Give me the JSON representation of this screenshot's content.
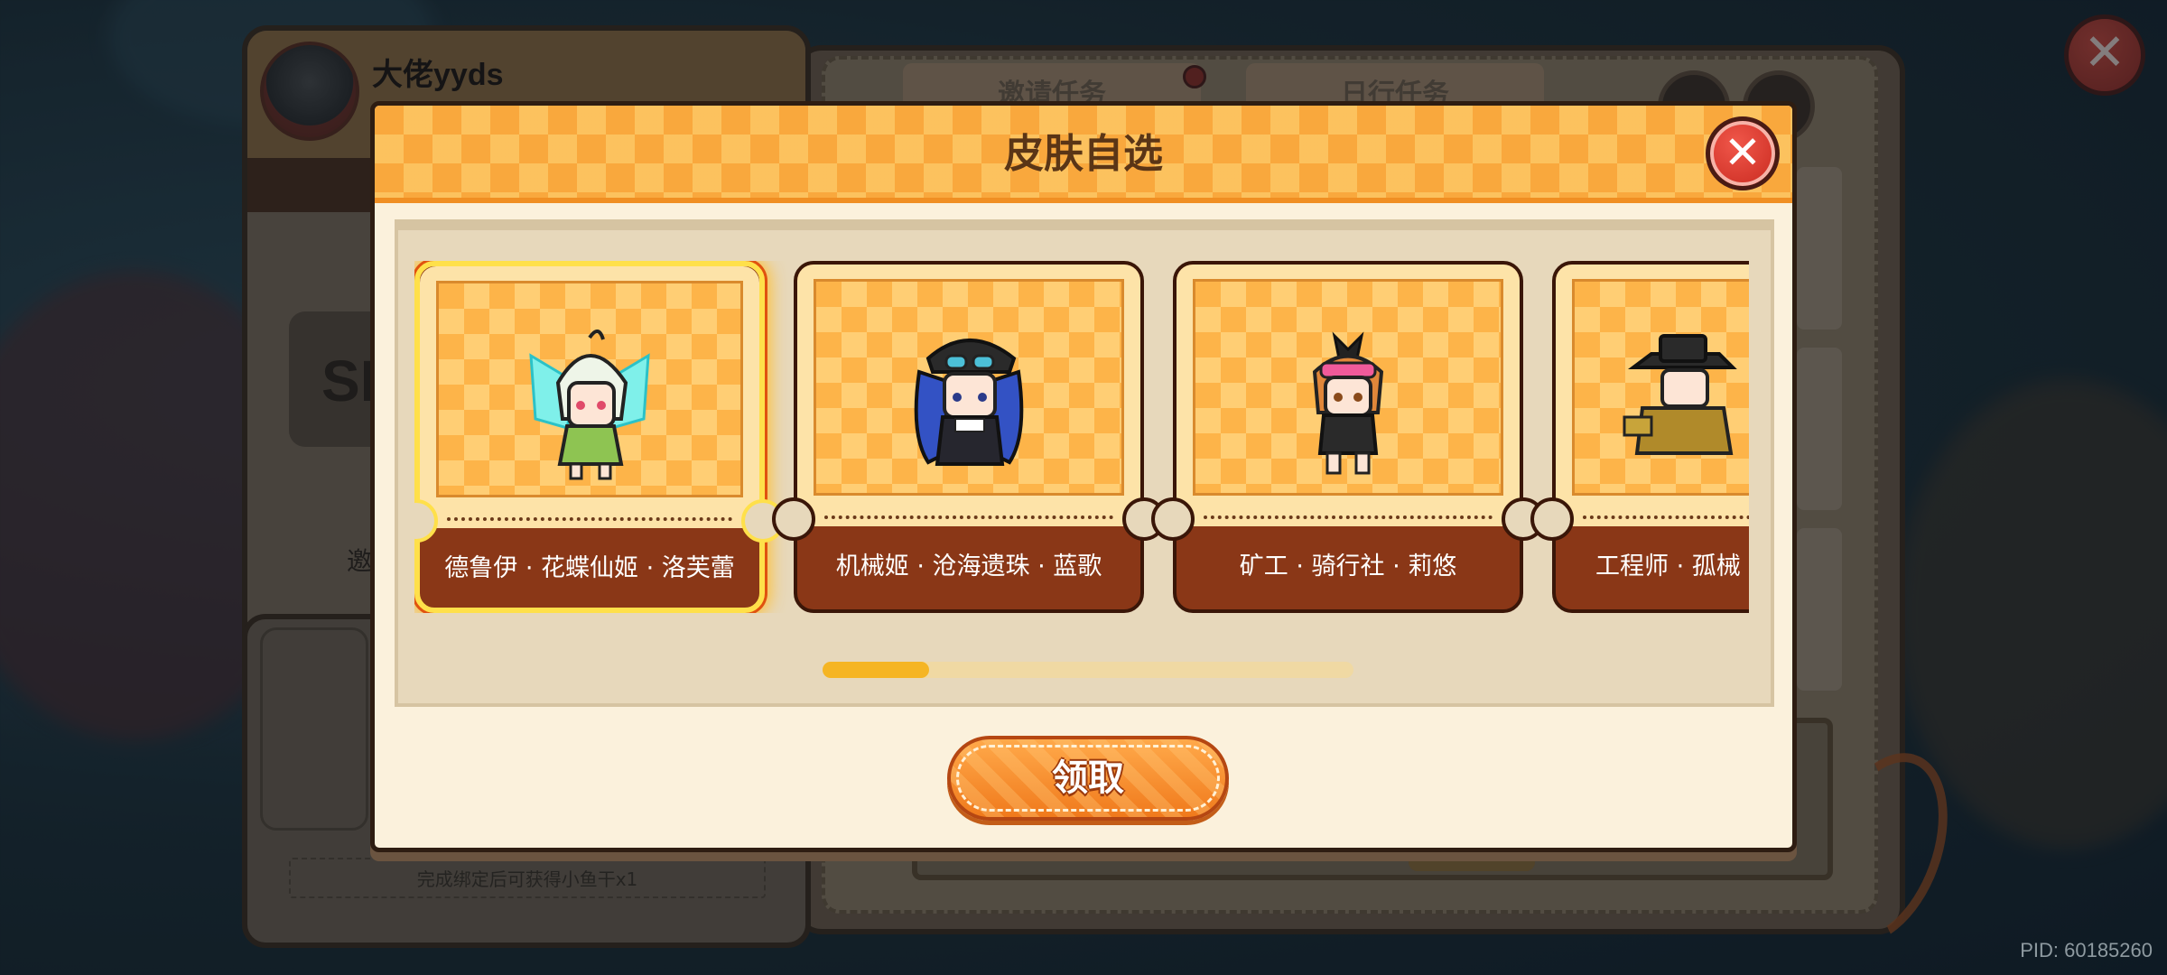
{
  "background": {
    "username": "大佬yyds",
    "code_prefix": "SK",
    "invite_char": "邀",
    "tabs": [
      "邀请任务",
      "日行任务"
    ],
    "footer_text": "完成绑定后可获得小鱼干x1",
    "close_glyph": "✕"
  },
  "dialog": {
    "title": "皮肤自选",
    "close_glyph": "✕",
    "skins": [
      {
        "label": "德鲁伊 · 花蝶仙姬 · 洛芙蕾",
        "selected": true,
        "icon": "fairy-character-sprite"
      },
      {
        "label": "机械姬 · 沧海遗珠 · 蓝歌",
        "selected": false,
        "icon": "captain-character-sprite"
      },
      {
        "label": "矿工 · 骑行社 · 莉悠",
        "selected": false,
        "icon": "miner-character-sprite"
      },
      {
        "label": "工程师 · 孤械",
        "selected": false,
        "icon": "engineer-character-sprite"
      }
    ],
    "scroll_progress": 0.2,
    "claim_label": "领取"
  },
  "watermark": "PID: 60185260",
  "colors": {
    "accent_orange": "#f9a83d",
    "selected_border": "#ffe04a",
    "card_dark": "#8a3717",
    "close_red": "#e0392d"
  }
}
